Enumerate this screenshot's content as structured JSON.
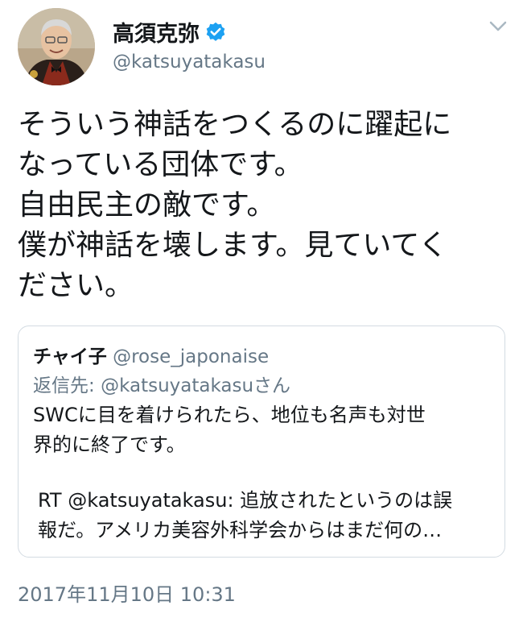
{
  "author": {
    "display_name": "高須克弥",
    "handle": "@katsuyatakasu",
    "verified_color": "#1da1f2"
  },
  "tweet": {
    "lines": [
      "そういう神話をつくるのに躍起に",
      "なっている団体です。",
      "自由民主の敵です。",
      "僕が神話を壊します。見ていてく",
      "ださい。"
    ]
  },
  "quoted_tweet": {
    "author_name": "チャイ子",
    "author_handle": "@rose_japonaise",
    "reply_prefix": "返信先: ",
    "reply_to": "@katsuyatakasu",
    "reply_suffix": "さん",
    "body_lines": [
      "SWCに目を着けられたら、地位も名声も対世",
      "界的に終了です。"
    ],
    "rt_lines": [
      "RT @katsuyatakasu: 追放されたというのは誤",
      "報だ。アメリカ美容外科学会からはまだ何の…"
    ]
  },
  "timestamp": "2017年11月10日 10:31",
  "icons": {
    "avatar": "profile-photo",
    "verified": "verified-badge-icon",
    "menu": "chevron-down-icon"
  }
}
